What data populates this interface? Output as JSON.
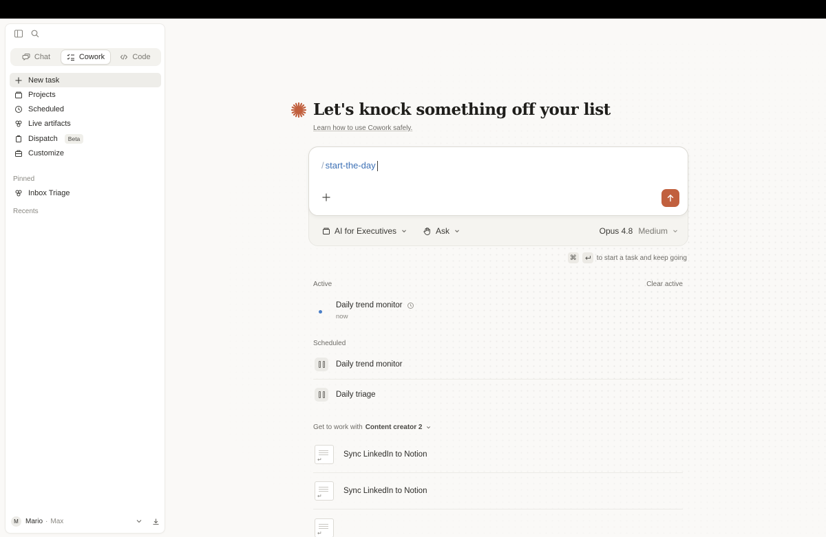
{
  "sidebar": {
    "tabs": [
      {
        "label": "Chat",
        "icon": "chat-icon",
        "active": false
      },
      {
        "label": "Cowork",
        "icon": "checklist-icon",
        "active": true
      },
      {
        "label": "Code",
        "icon": "code-icon",
        "active": false
      }
    ],
    "nav": {
      "new_task": "New task",
      "projects": "Projects",
      "scheduled": "Scheduled",
      "live_artifacts": "Live artifacts",
      "dispatch": "Dispatch",
      "dispatch_badge": "Beta",
      "customize": "Customize"
    },
    "pinned_label": "Pinned",
    "pinned": [
      "Inbox Triage"
    ],
    "recents_label": "Recents",
    "footer": {
      "avatar_initial": "M",
      "user": "Mario",
      "separator": "·",
      "plan": "Max"
    }
  },
  "main": {
    "title": "Let's knock something off your list",
    "learn_link": "Learn how to use Cowork safely.",
    "composer": {
      "slash": "/",
      "command": "start-the-day"
    },
    "controls": {
      "project": "AI for Executives",
      "mode": "Ask",
      "model": "Opus 4.8",
      "effort": "Medium"
    },
    "hint": "to start a task and keep going",
    "active": {
      "label": "Active",
      "clear": "Clear active",
      "items": [
        {
          "title": "Daily trend monitor",
          "sub": "now"
        }
      ]
    },
    "scheduled": {
      "label": "Scheduled",
      "items": [
        "Daily trend monitor",
        "Daily triage"
      ]
    },
    "get_to_work": {
      "prefix": "Get to work with",
      "agent": "Content creator 2",
      "items": [
        "Sync LinkedIn to Notion",
        "Sync LinkedIn to Notion"
      ]
    }
  },
  "colors": {
    "accent": "#c1603e",
    "link_blue": "#3c70b5",
    "active_dot": "#4a7ec7"
  }
}
